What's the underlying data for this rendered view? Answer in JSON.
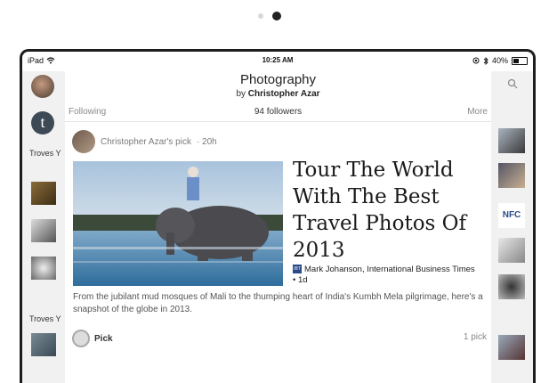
{
  "pager": {
    "count": 2,
    "active": 1
  },
  "status": {
    "carrier": "iPad",
    "time": "10:25 AM",
    "battery": "40%"
  },
  "header": {
    "title": "Photography",
    "by_prefix": "by",
    "author": "Christopher Azar"
  },
  "nav": {
    "following": "Following",
    "followers": "94 followers",
    "more": "More"
  },
  "left_rail": {
    "label1": "Troves Y",
    "label2": "Troves Y",
    "avatar_letter": "t"
  },
  "right_rail": {
    "nfc": "NFC"
  },
  "post": {
    "pick_by": "Christopher Azar's pick",
    "age": "· 20h",
    "headline": "Tour The World With The Best Travel Photos Of 2013",
    "source": "Mark Johanson, International Business Times",
    "source_age": "• 1d",
    "source_logo": "IBT",
    "summary": "From the jubilant mud mosques of Mali to the thumping heart of India's Kumbh Mela pilgrimage, here's a snapshot of the globe in 2013.",
    "pick_label": "Pick",
    "pick_count": "1 pick"
  }
}
